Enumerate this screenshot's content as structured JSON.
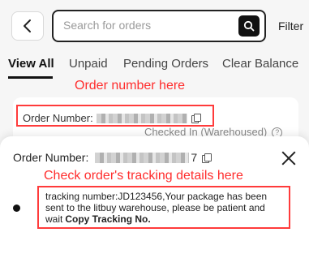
{
  "header": {
    "search_placeholder": "Search for orders",
    "filter_label": "Filter"
  },
  "tabs": [
    {
      "label": "View All",
      "active": true
    },
    {
      "label": "Unpaid",
      "active": false
    },
    {
      "label": "Pending Orders",
      "active": false
    },
    {
      "label": "Clear Balance",
      "active": false
    }
  ],
  "annotations": {
    "order_number_hint": "Order number here",
    "tracking_hint": "Check order's tracking details here"
  },
  "order_card": {
    "order_number_label": "Order Number:",
    "status": "Checked In (Warehoused)"
  },
  "tracking_sheet": {
    "order_number_label": "Order Number:",
    "order_number_visible_tail": "7",
    "tracking_message": "tracking number:JD123456,Your package has been sent to the litbuy warehouse, please be patient and wait",
    "copy_tracking_label": "Copy Tracking No."
  },
  "colors": {
    "annotation_red": "#ff2d2d",
    "accent_dark": "#111111"
  },
  "icons": {
    "back": "chevron-left-icon",
    "search": "search-icon",
    "copy": "copy-icon",
    "help": "help-icon",
    "close": "close-icon"
  }
}
